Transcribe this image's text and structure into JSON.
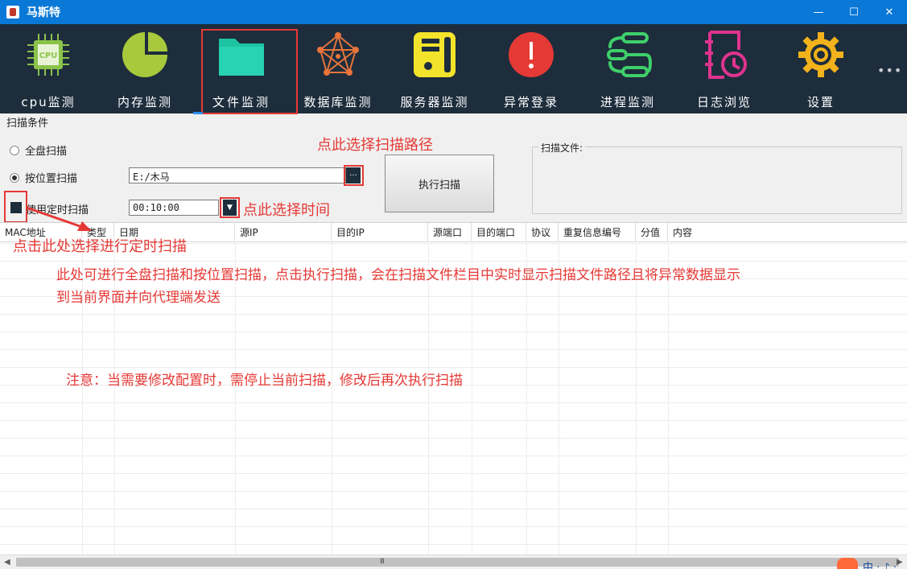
{
  "window": {
    "title": "马斯特",
    "buttons": {
      "minimize": "—",
      "maximize": "☐",
      "close": "✕"
    }
  },
  "toolbar": {
    "items": [
      {
        "label": "cpu监测",
        "icon": "cpu-icon",
        "color": "#8bc34a"
      },
      {
        "label": "内存监测",
        "icon": "pie-chart-icon",
        "color": "#a8c93b"
      },
      {
        "label": "文件监测",
        "icon": "folder-icon",
        "color": "#1ec3a4",
        "active": true
      },
      {
        "label": "数据库监测",
        "icon": "network-icon",
        "color": "#e8743b"
      },
      {
        "label": "服务器监测",
        "icon": "server-icon",
        "color": "#f3e32b"
      },
      {
        "label": "异常登录",
        "icon": "alert-icon",
        "color": "#e53935"
      },
      {
        "label": "进程监测",
        "icon": "process-flow-icon",
        "color": "#3fcf6a"
      },
      {
        "label": "日志浏览",
        "icon": "log-clock-icon",
        "color": "#e0338f"
      },
      {
        "label": "设置",
        "icon": "gear-icon",
        "color": "#f2b21b"
      }
    ],
    "more": "•••"
  },
  "scan": {
    "section_title": "扫描条件",
    "full_disk_label": "全盘扫描",
    "by_location_label": "按位置扫描",
    "path_value": "E:/木马",
    "browse_label": "···",
    "timer_label": "使用定时扫描",
    "time_value": "00:10:00",
    "dropdown_glyph": "▼",
    "execute_label": "执行扫描",
    "scan_files_label": "扫描文件:"
  },
  "annotations": {
    "path_hint": "点此选择扫描路径",
    "time_hint": "点此选择时间",
    "timer_hint": "点击此处选择进行定时扫描",
    "desc": "此处可进行全盘扫描和按位置扫描，点击执行扫描，会在扫描文件栏目中实时显示扫描文件路径且将异常数据显示",
    "desc2": "到当前界面并向代理端发送",
    "note": "注意：当需要修改配置时，需停止当前扫描，修改后再次执行扫描"
  },
  "table": {
    "columns": [
      "MAC地址",
      "类型",
      "日期",
      "源IP",
      "目的IP",
      "源端口",
      "目的端口",
      "协议",
      "重复信息编号",
      "分值",
      "内容"
    ]
  },
  "statusbar": {
    "ime": "中",
    "ime_extra": "· ♪ ·",
    "scroll_grip": "III"
  },
  "colors": {
    "toolbar_bg": "#1d2d3c",
    "titlebar_bg": "#0a78d7",
    "annotation": "#e53935"
  }
}
